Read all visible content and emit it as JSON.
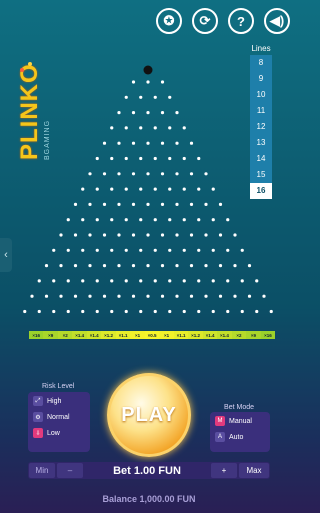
{
  "top_icons": [
    {
      "name": "medal-icon",
      "glyph": "✪"
    },
    {
      "name": "history-icon",
      "glyph": "⟳"
    },
    {
      "name": "help-icon",
      "glyph": "?"
    },
    {
      "name": "sound-icon",
      "glyph": "◀)"
    }
  ],
  "logo": {
    "title": "PLINKO",
    "subtitle": "BGAMING"
  },
  "lines": {
    "title": "Lines",
    "options": [
      "8",
      "9",
      "10",
      "11",
      "12",
      "13",
      "14",
      "15",
      "16"
    ],
    "selected": "16"
  },
  "board": {
    "rows": 16,
    "ball_color": "#111111"
  },
  "buckets": [
    {
      "label": "×16",
      "color": "#9bd12a"
    },
    {
      "label": "×9",
      "color": "#a8d52a"
    },
    {
      "label": "×2",
      "color": "#b5da2a"
    },
    {
      "label": "×1.4",
      "color": "#c2df2a"
    },
    {
      "label": "×1.4",
      "color": "#cfe42a"
    },
    {
      "label": "×1.2",
      "color": "#dce92a"
    },
    {
      "label": "×1.1",
      "color": "#e8ee2a"
    },
    {
      "label": "×1",
      "color": "#f2f22a"
    },
    {
      "label": "×0.5",
      "color": "#f5f52a"
    },
    {
      "label": "×1",
      "color": "#f2f22a"
    },
    {
      "label": "×1.1",
      "color": "#e8ee2a"
    },
    {
      "label": "×1.2",
      "color": "#dce92a"
    },
    {
      "label": "×1.4",
      "color": "#cfe42a"
    },
    {
      "label": "×1.4",
      "color": "#c2df2a"
    },
    {
      "label": "×2",
      "color": "#b5da2a"
    },
    {
      "label": "×9",
      "color": "#a8d52a"
    },
    {
      "label": "×16",
      "color": "#9bd12a"
    }
  ],
  "risk": {
    "title": "Risk Level",
    "options": [
      {
        "label": "High",
        "icon": "⤢"
      },
      {
        "label": "Normal",
        "icon": "⚙"
      },
      {
        "label": "Low",
        "icon": "⇩"
      }
    ],
    "selected": "Low"
  },
  "play_label": "PLAY",
  "bet_mode": {
    "title": "Bet Mode",
    "options": [
      {
        "label": "Manual",
        "icon": "M"
      },
      {
        "label": "Auto",
        "icon": "A"
      }
    ],
    "selected": "Manual"
  },
  "bet": {
    "min_label": "Min",
    "minus_label": "–",
    "text": "Bet 1.00 FUN",
    "plus_label": "+",
    "max_label": "Max"
  },
  "balance": "Balance 1,000.00 FUN"
}
